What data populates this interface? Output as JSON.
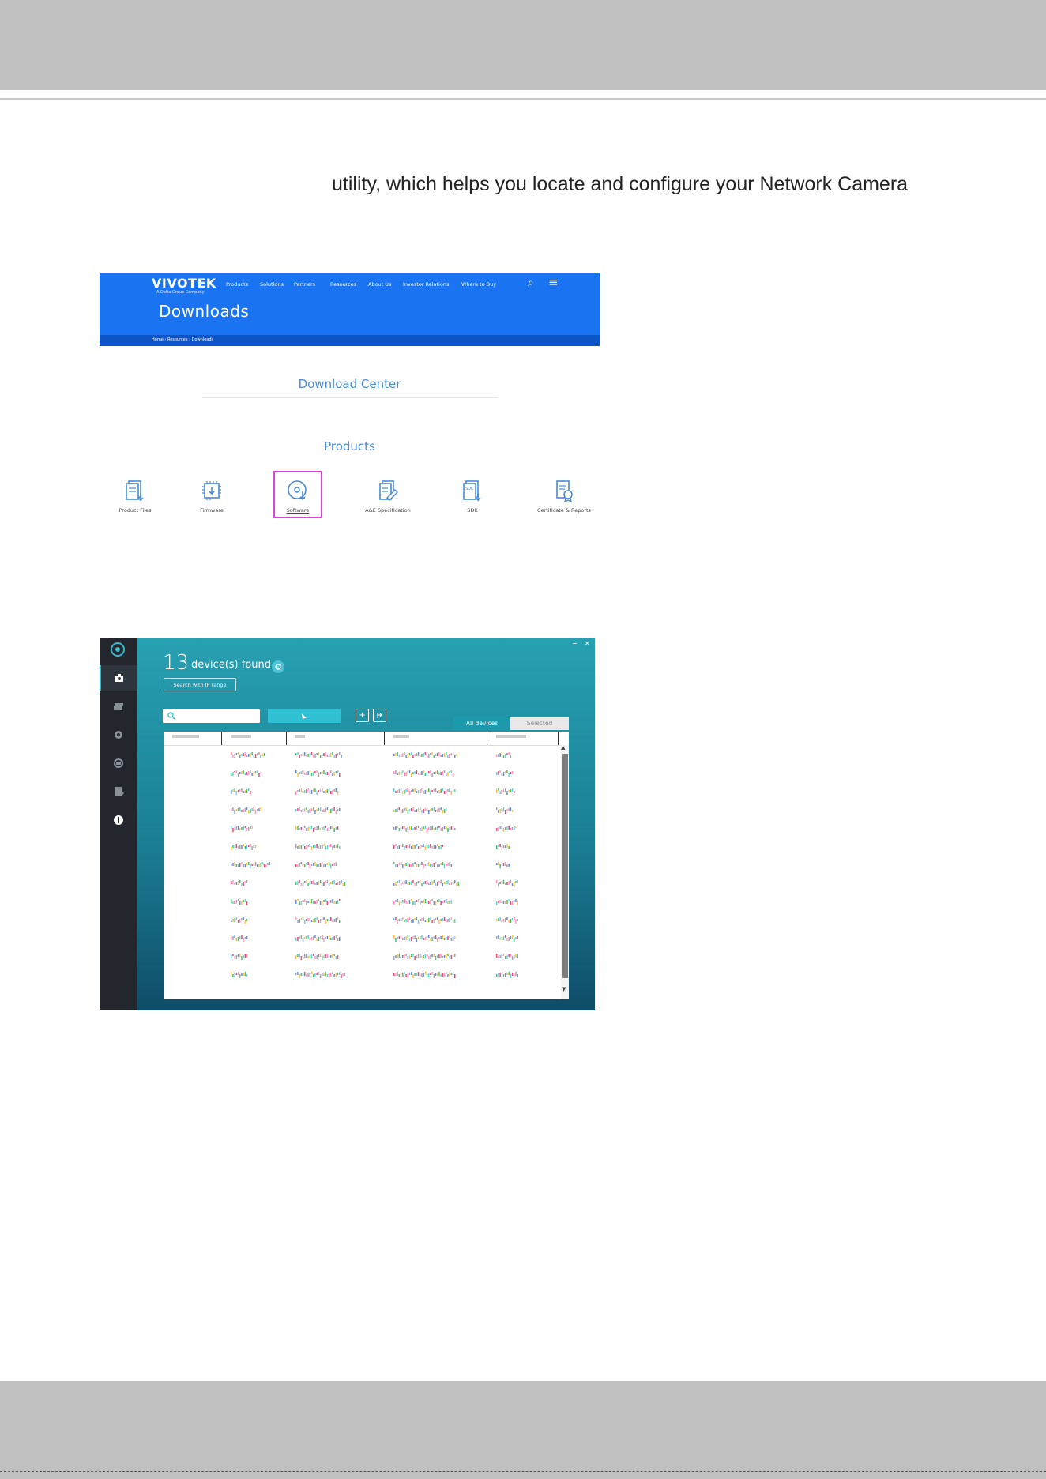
{
  "document": {
    "body_text": "utility, which helps you locate and configure your Network Camera"
  },
  "website": {
    "logo": "VIVOTEK",
    "logo_sub": "A Delta Group Company",
    "nav": [
      "Products",
      "Solutions",
      "Partners",
      "Resources",
      "About Us",
      "Investor Relations",
      "Where to Buy"
    ],
    "banner_title": "Downloads",
    "breadcrumb": "Home › Resources › Downloads",
    "download_center": "Download Center",
    "products_heading": "Products",
    "categories": [
      {
        "label": "Product Files",
        "icon": "document-download-icon"
      },
      {
        "label": "Firmware",
        "icon": "chip-download-icon"
      },
      {
        "label": "Software",
        "icon": "disc-download-icon",
        "selected": true
      },
      {
        "label": "A&E Specification",
        "icon": "spec-edit-icon"
      },
      {
        "label": "SDK",
        "icon": "sdk-download-icon"
      },
      {
        "label": "Certificate & Reports",
        "icon": "certificate-icon"
      }
    ],
    "colors": {
      "banner": "#1a73f0",
      "accent": "#4a8bd6",
      "highlight": "#e040e0"
    }
  },
  "app": {
    "device_count": "13",
    "found_label": "device(s) found",
    "ip_range_button": "Search with IP range",
    "tabs": {
      "all": "All devices",
      "selected": "Selected"
    },
    "rail_icons": [
      "camera-icon",
      "stack-icon",
      "settings-icon",
      "sync-icon",
      "export-icon",
      "info-icon"
    ],
    "colors": {
      "teal": "#27a1b2",
      "rail": "#23272d"
    }
  }
}
